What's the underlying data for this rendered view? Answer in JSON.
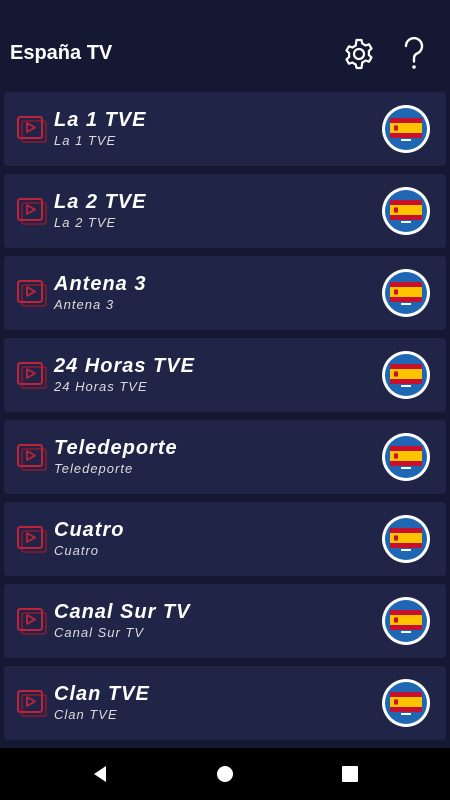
{
  "app": {
    "title": "España TV",
    "icons": [
      "gear-icon",
      "help-icon"
    ]
  },
  "channels": [
    {
      "name": "La 1 TVE",
      "subtitle": "La 1 TVE",
      "flag": "spain-flag-icon"
    },
    {
      "name": "La 2 TVE",
      "subtitle": "La 2 TVE",
      "flag": "spain-flag-icon"
    },
    {
      "name": "Antena 3",
      "subtitle": "Antena 3",
      "flag": "spain-flag-icon"
    },
    {
      "name": "24 Horas TVE",
      "subtitle": "24 Horas TVE",
      "flag": "spain-flag-icon"
    },
    {
      "name": "Teledeporte",
      "subtitle": "Teledeporte",
      "flag": "spain-flag-icon"
    },
    {
      "name": "Cuatro",
      "subtitle": "Cuatro",
      "flag": "spain-flag-icon"
    },
    {
      "name": "Canal Sur TV",
      "subtitle": "Canal Sur TV",
      "flag": "spain-flag-icon"
    },
    {
      "name": "Clan TVE",
      "subtitle": "Clan TVE",
      "flag": "spain-flag-icon"
    }
  ],
  "colors": {
    "background": "#151833",
    "card": "#202447",
    "play_icon": "#c0223a",
    "flag_ring": "#1f66b3",
    "flag_red": "#c8102e",
    "flag_yellow": "#ffc400"
  },
  "navbar": {
    "icons": [
      "back-icon",
      "home-icon",
      "recent-apps-icon"
    ]
  }
}
